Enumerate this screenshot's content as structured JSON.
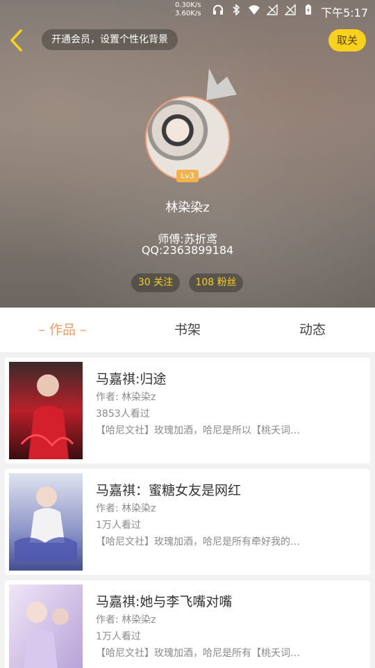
{
  "status_bar": {
    "speed_up": "0.30K/s",
    "speed_down": "3.60K/s",
    "time": "下午5:17",
    "icons": [
      "headphones-icon",
      "bluetooth-icon",
      "wifi-icon",
      "no-signal-icon",
      "no-signal-icon",
      "battery-charging-icon"
    ]
  },
  "header": {
    "vip_banner": "开通会员，设置个性化背景",
    "cancel_follow_label": "取关",
    "level_badge": "Lv3",
    "nickname": "林染染z",
    "master": "师傅:苏折鸢",
    "qq": "QQ:2363899184",
    "following": "30 关注",
    "fans": "108 粉丝"
  },
  "colors": {
    "accent_yellow": "#f8d11c",
    "tab_active": "#f19a64",
    "avatar_border": "#f0a07a"
  },
  "tabs": [
    {
      "label": "– 作品 –",
      "active": true
    },
    {
      "label": "书架",
      "active": false
    },
    {
      "label": "动态",
      "active": false
    }
  ],
  "works": [
    {
      "title": "马嘉祺:归途",
      "author": "作者: 林染染z",
      "views": "3853人看过",
      "desc": "【哈尼文社】玫瑰加酒，哈尼是所以【桃夭词…"
    },
    {
      "title": "马嘉祺：蜜糖女友是网红",
      "author": "作者: 林染染z",
      "views": "1万人看过",
      "desc": "【哈尼文社】玫瑰加酒，哈尼是所有牵好我的…"
    },
    {
      "title": "马嘉祺:她与李飞嘴对嘴",
      "author": "作者: 林染染z",
      "views": "1万人看过",
      "desc": "【哈尼文社】玫瑰加酒，哈尼是所有【桃夭词…"
    }
  ]
}
